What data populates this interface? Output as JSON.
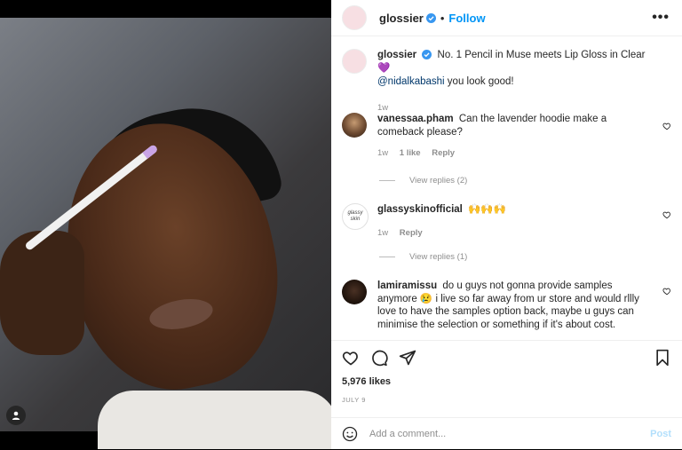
{
  "post": {
    "username": "glossier",
    "follow_label": "Follow",
    "separator": "•",
    "more_label": "•••"
  },
  "caption": {
    "username": "glossier",
    "text": "No. 1 Pencil in Muse meets Lip Gloss in Clear 💜",
    "mention": "@nidalkabashi",
    "mention_rest": " you look good!",
    "time": "1w"
  },
  "comments": [
    {
      "username": "vanessaa.pham",
      "text": "Can the lavender hoodie make a comeback please?",
      "time": "1w",
      "likes": "1 like",
      "reply_label": "Reply",
      "view_replies": "View replies (2)"
    },
    {
      "username": "glassyskinofficial",
      "text": "🙌🙌🙌",
      "time": "1w",
      "reply_label": "Reply",
      "view_replies": "View replies (1)",
      "avatar_text": "glassy skin"
    },
    {
      "username": "lamiramissu",
      "text": "do u guys not gonna provide samples anymore 😢 i live so far away from ur store and would rllly love to have the samples option back, maybe u guys can minimise the selection or something if it's about cost."
    }
  ],
  "stats": {
    "likes": "5,976 likes",
    "date": "JULY 9"
  },
  "composer": {
    "placeholder": "Add a comment...",
    "post_label": "Post"
  },
  "colors": {
    "accent": "#0095f6",
    "post_disabled": "#b2dffc",
    "verified": "#3897f0"
  }
}
